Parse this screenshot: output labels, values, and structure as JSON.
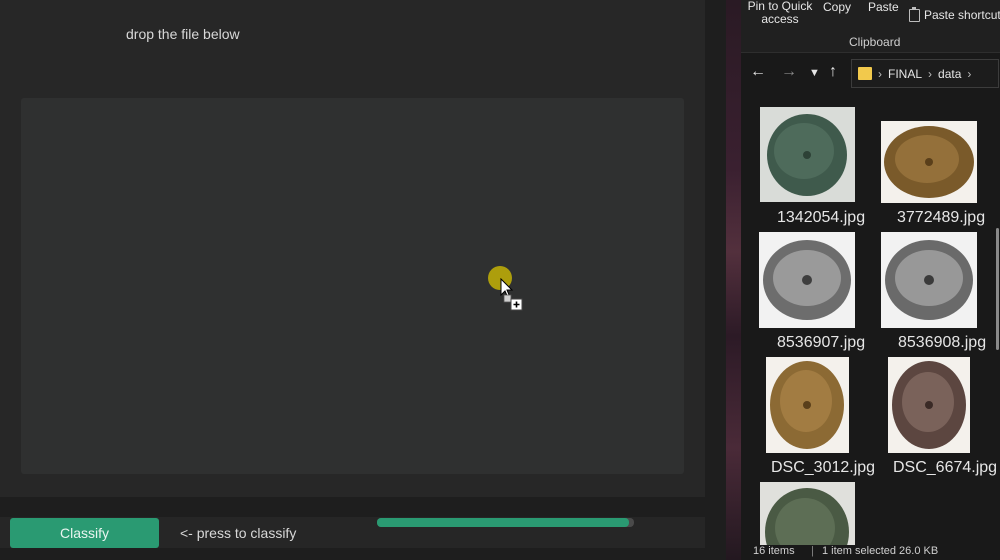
{
  "app": {
    "drop_label": "drop the file below",
    "classify_button": "Classify",
    "hint": "<- press to classify",
    "progress": 0.98,
    "accent": "#2a9a72"
  },
  "explorer": {
    "ribbon": {
      "pin_quick_access": "Pin to Quick access",
      "copy": "Copy",
      "paste": "Paste",
      "paste_shortcut": "Paste shortcut",
      "group_label": "Clipboard"
    },
    "address": {
      "crumbs": [
        "FINAL",
        "data"
      ]
    },
    "files": [
      {
        "name": "1342054.jpg",
        "icon": "coin-green-icon"
      },
      {
        "name": "3772489.jpg",
        "icon": "coin-bronze-icon"
      },
      {
        "name": "8536907.jpg",
        "icon": "coin-silver-icon"
      },
      {
        "name": "8536908.jpg",
        "icon": "coin-silver-icon"
      },
      {
        "name": "DSC_3012.jpg",
        "icon": "coin-bronze-icon"
      },
      {
        "name": "DSC_6674.jpg",
        "icon": "coin-brown-icon"
      },
      {
        "name": "",
        "icon": "coin-green-icon"
      }
    ],
    "status": {
      "items": "16 items",
      "selected": "1 item selected  26.0 KB"
    }
  }
}
